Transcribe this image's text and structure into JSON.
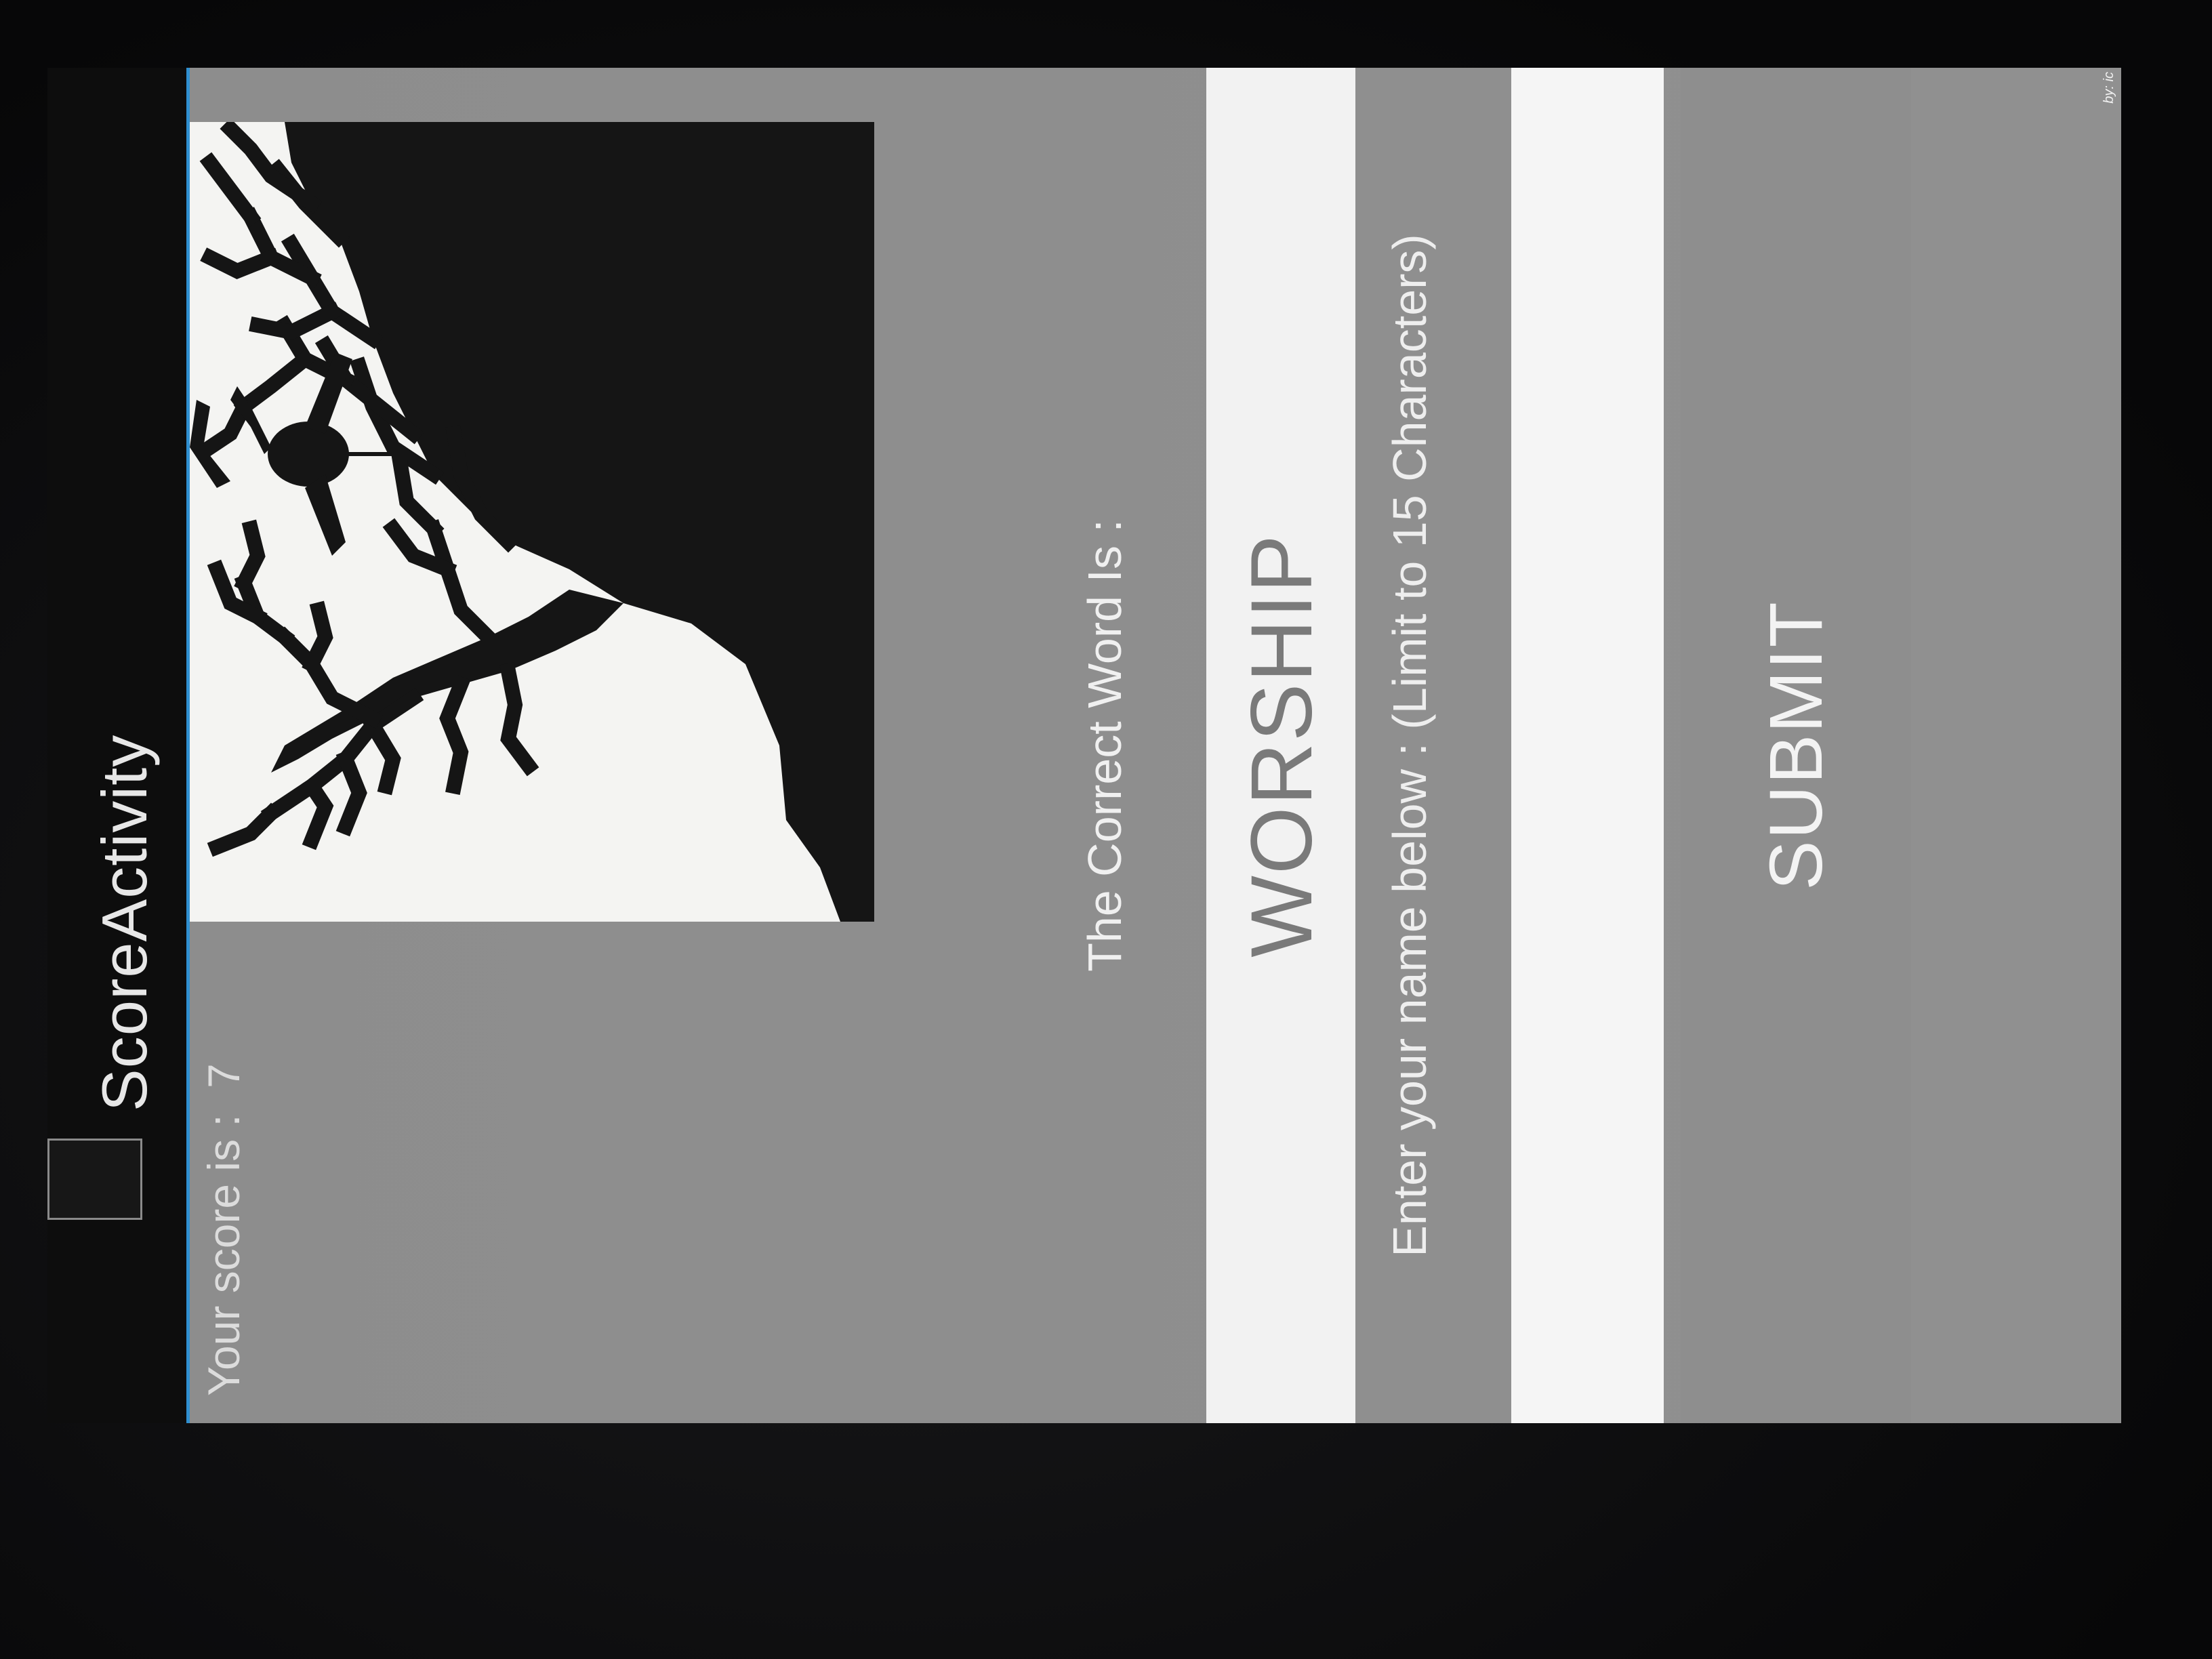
{
  "app": {
    "title": "ScoreActivity"
  },
  "score": {
    "label": "Your score is :",
    "value": "7"
  },
  "result": {
    "correct_label": "The Correct Word Is :",
    "correct_word": "WORSHIP"
  },
  "name_entry": {
    "prompt": "Enter your name below : (Limit to 15 Characters)",
    "value": ""
  },
  "actions": {
    "submit_label": "SUBMIT"
  },
  "footer": {
    "credit": "by: ic"
  },
  "icons": {
    "app_icon": "app-icon",
    "image": "hanging-tree-image"
  },
  "colors": {
    "accent": "#2f8fd0",
    "action_bar": "#0d0d0d",
    "content_bg": "#8d8d8d",
    "field_bg": "#f2f2f2"
  }
}
